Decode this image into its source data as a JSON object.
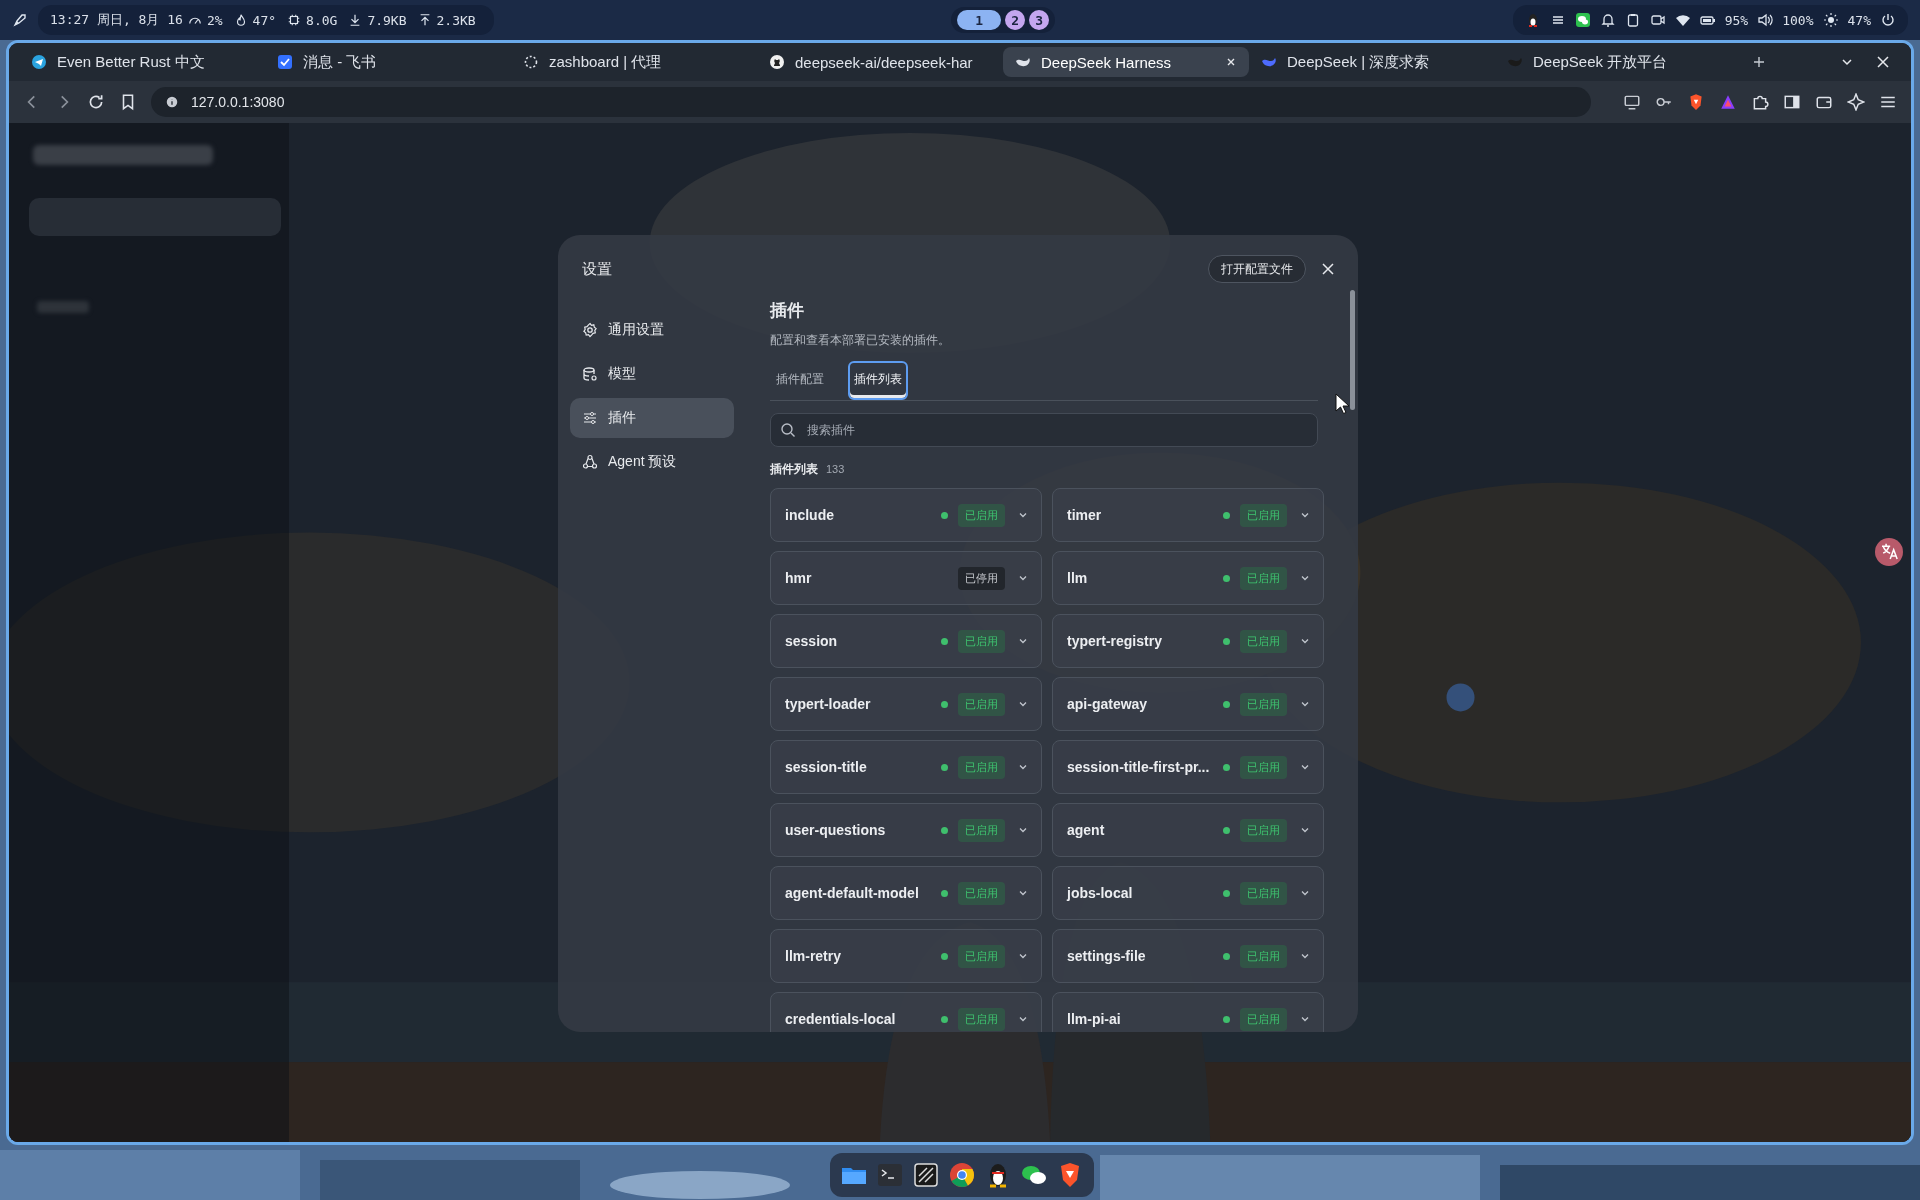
{
  "status_bar": {
    "clock": "13:27 周日, 8月 16",
    "cpu": "2%",
    "temperature": "47°",
    "memory": "8.0G",
    "download": "7.9KB",
    "upload": "2.3KB",
    "workspaces": [
      {
        "label": "1",
        "selected": true
      },
      {
        "label": "2",
        "selected": false
      },
      {
        "label": "3",
        "selected": false
      }
    ],
    "battery": "95%",
    "volume": "100%",
    "brightness": "47%"
  },
  "browser": {
    "tabs": [
      {
        "title": "Even Better Rust 中文",
        "selected": false
      },
      {
        "title": "消息 - 飞书",
        "selected": false
      },
      {
        "title": "zashboard | 代理",
        "selected": false
      },
      {
        "title": "deepseek-ai/deepseek-har",
        "selected": false
      },
      {
        "title": "DeepSeek Harness",
        "selected": true
      },
      {
        "title": "DeepSeek | 深度求索",
        "selected": false
      },
      {
        "title": "DeepSeek 开放平台",
        "selected": false
      }
    ],
    "url": "127.0.0.1:3080"
  },
  "settings": {
    "title": "设置",
    "open_config_button": "打开配置文件",
    "nav": [
      {
        "label": "通用设置",
        "selected": false
      },
      {
        "label": "模型",
        "selected": false
      },
      {
        "label": "插件",
        "selected": true
      },
      {
        "label": "Agent 预设",
        "selected": false
      }
    ],
    "heading": "插件",
    "description": "配置和查看本部署已安装的插件。",
    "tabs": [
      {
        "label": "插件配置",
        "selected": false
      },
      {
        "label": "插件列表",
        "selected": true
      }
    ],
    "search": {
      "placeholder": "搜索插件"
    },
    "list_title": "插件列表",
    "count": "133",
    "plugins": [
      {
        "name": "include",
        "enabled": true,
        "status": "已启用"
      },
      {
        "name": "timer",
        "enabled": true,
        "status": "已启用"
      },
      {
        "name": "hmr",
        "enabled": false,
        "status": "已停用"
      },
      {
        "name": "llm",
        "enabled": true,
        "status": "已启用"
      },
      {
        "name": "session",
        "enabled": true,
        "status": "已启用"
      },
      {
        "name": "typert-registry",
        "enabled": true,
        "status": "已启用"
      },
      {
        "name": "typert-loader",
        "enabled": true,
        "status": "已启用"
      },
      {
        "name": "api-gateway",
        "enabled": true,
        "status": "已启用"
      },
      {
        "name": "session-title",
        "enabled": true,
        "status": "已启用"
      },
      {
        "name": "session-title-first-pr...",
        "enabled": true,
        "status": "已启用"
      },
      {
        "name": "user-questions",
        "enabled": true,
        "status": "已启用"
      },
      {
        "name": "agent",
        "enabled": true,
        "status": "已启用"
      },
      {
        "name": "agent-default-model",
        "enabled": true,
        "status": "已启用"
      },
      {
        "name": "jobs-local",
        "enabled": true,
        "status": "已启用"
      },
      {
        "name": "llm-retry",
        "enabled": true,
        "status": "已启用"
      },
      {
        "name": "settings-file",
        "enabled": true,
        "status": "已启用"
      },
      {
        "name": "credentials-local",
        "enabled": true,
        "status": "已启用"
      },
      {
        "name": "llm-pi-ai",
        "enabled": true,
        "status": "已启用"
      }
    ]
  }
}
